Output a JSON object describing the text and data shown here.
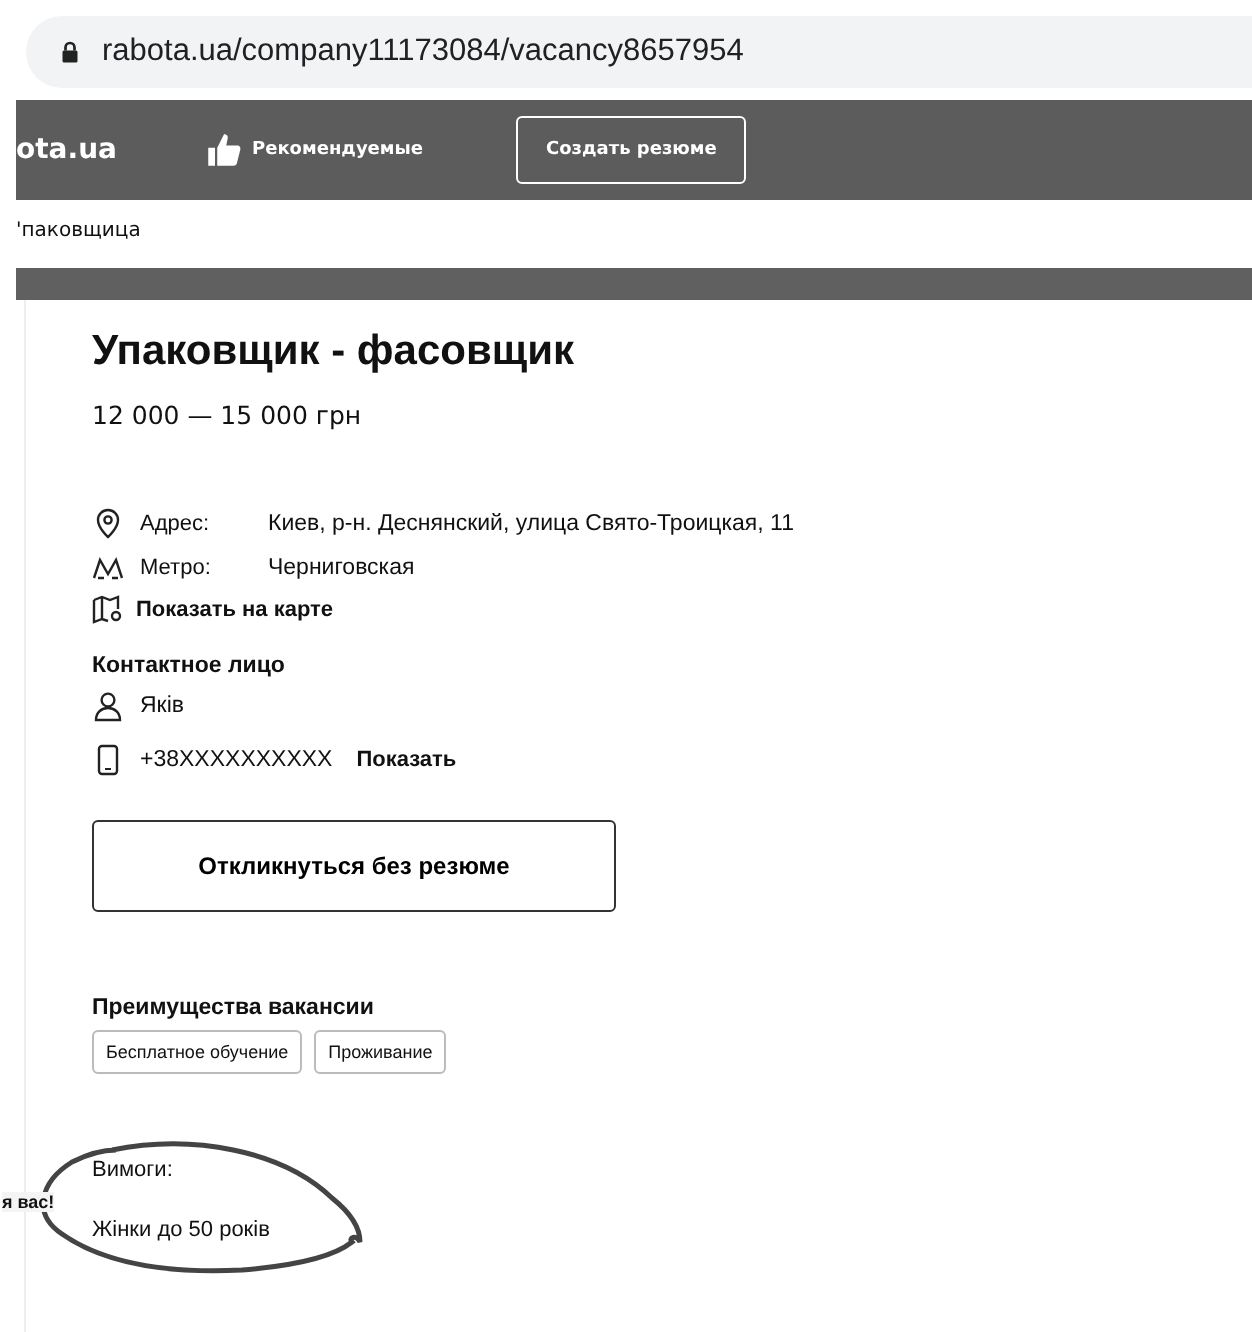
{
  "address_bar": {
    "url": "rabota.ua/company11173084/vacancy8657954"
  },
  "header": {
    "logo": "ota.ua",
    "recommended": "Рекомендуемые",
    "create_resume": "Создать резюме"
  },
  "breadcrumb": "'паковщица",
  "vacancy": {
    "title": "Упаковщик - фасовщик",
    "salary": "12 000 — 15 000 грн",
    "details": [
      {
        "kind": "address",
        "label": "Адрес:",
        "value": "Киев, р-н. Деснянский, улица Свято-Троицкая, 11"
      },
      {
        "kind": "metro",
        "label": "Метро:",
        "value": "Черниговская"
      }
    ],
    "map_link": "Показать на карте",
    "contact": {
      "heading": "Контактное лицо",
      "name": "Яків",
      "phone": "+38XXXXXXXXXX",
      "show_phone": "Показать"
    },
    "apply_button": "Откликнуться без резюме",
    "benefits": {
      "heading": "Преимущества вакансии",
      "tags": [
        "Бесплатное обучение",
        "Проживание"
      ]
    },
    "requirements": {
      "heading": "Вимоги:",
      "items": [
        "Жінки до 50 років"
      ]
    },
    "side_note": "я вас!"
  }
}
